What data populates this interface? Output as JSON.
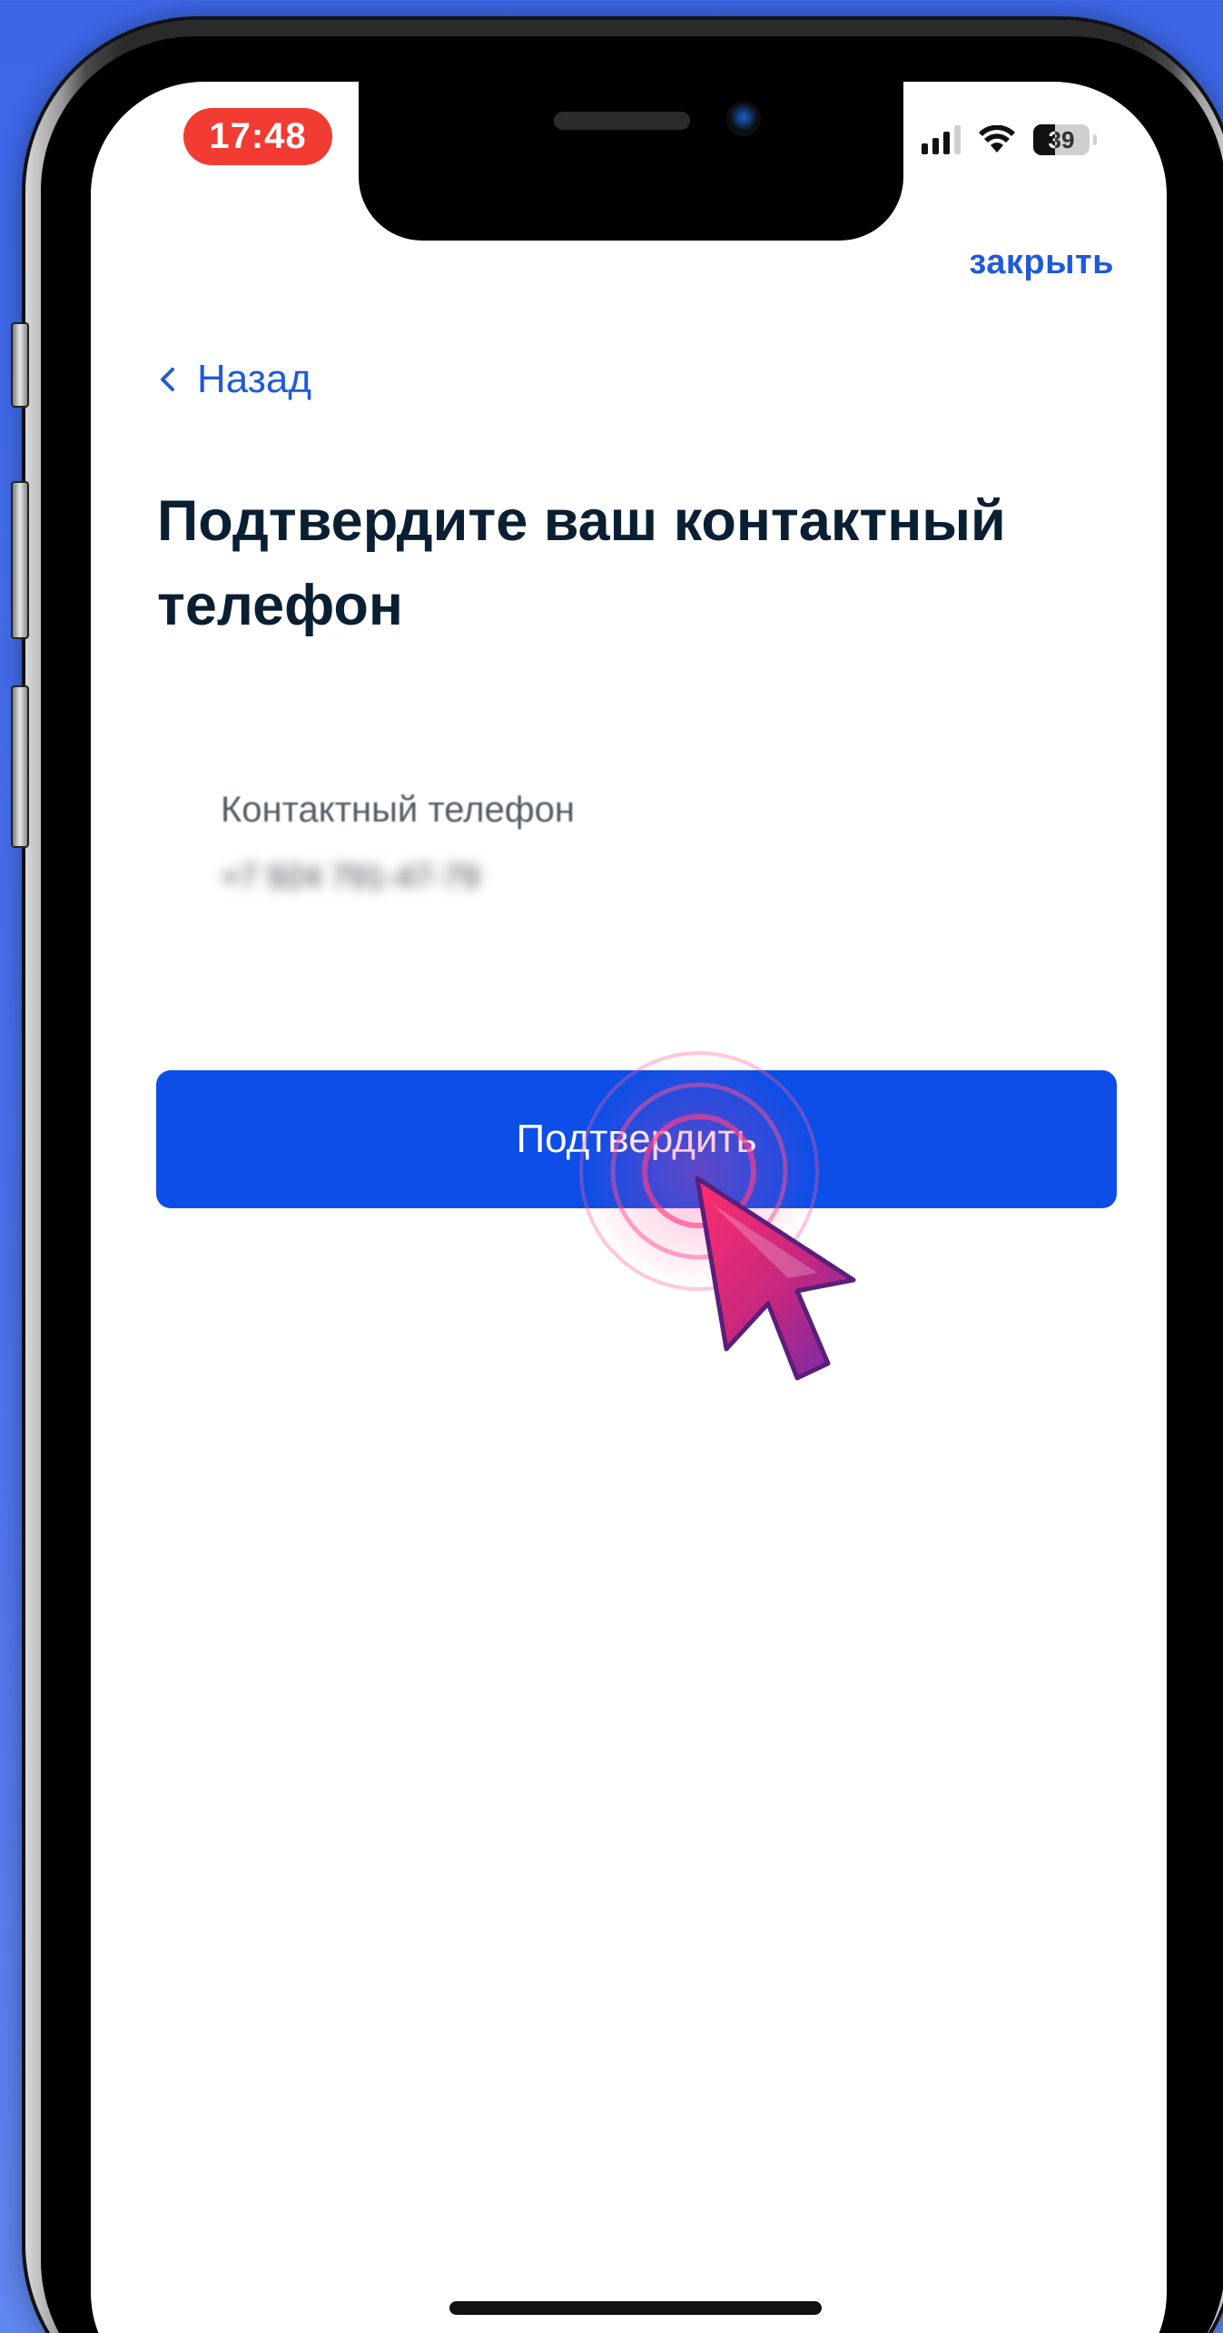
{
  "status_bar": {
    "time": "17:48",
    "battery": "39"
  },
  "header": {
    "close_label": "закрыть",
    "back_label": "Назад"
  },
  "main": {
    "title": "Подтвердите ваш контактный телефон",
    "phone_label": "Контактный телефон",
    "phone_value": "+7 924 791-47-79",
    "confirm_label": "Подтвердить"
  },
  "colors": {
    "accent": "#0d4ee8",
    "link": "#1f5bd8",
    "background": "#3c66e6",
    "time_pill": "#f23b32"
  },
  "icons": [
    "chevron-left-icon",
    "signal-icon",
    "wifi-icon",
    "battery-icon",
    "mouse-pointer-icon",
    "tap-ripple"
  ]
}
